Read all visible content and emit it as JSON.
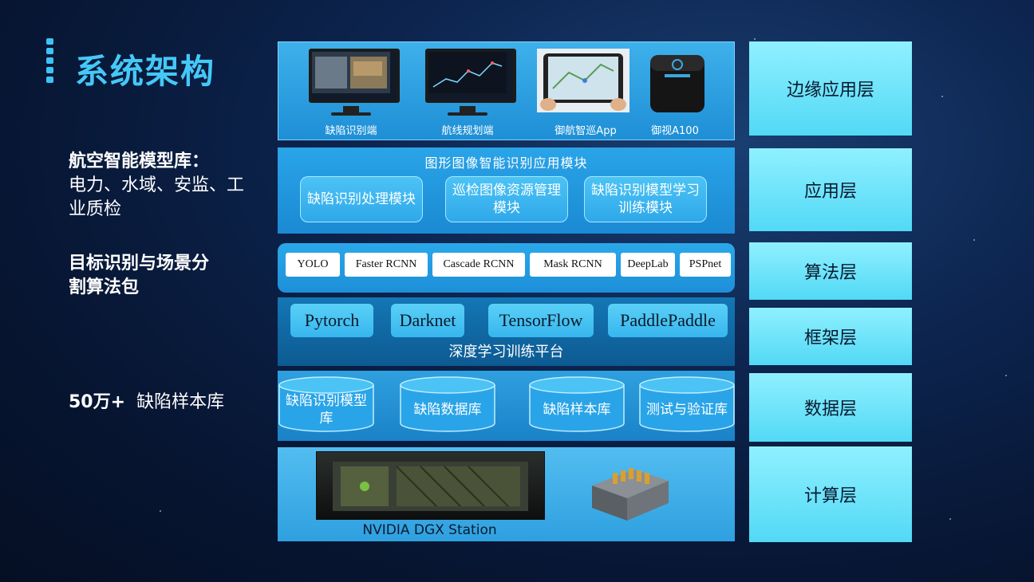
{
  "title": "系统架构",
  "notes": [
    {
      "bold": "航空智能模型库：",
      "text": "电力、水域、安监、工业质检"
    },
    {
      "bold": "目标识别与场景分割算法包",
      "text": ""
    },
    {
      "bold": "50万+",
      "text": "缺陷样本库"
    }
  ],
  "layers": {
    "edge": {
      "label": "边缘应用层",
      "devices": [
        "缺陷识别端",
        "航线规划端",
        "御航智巡App",
        "御视A100"
      ]
    },
    "app": {
      "label": "应用层",
      "title": "图形图像智能识别应用模块",
      "modules": [
        "缺陷识别处理模块",
        "巡检图像资源管理模块",
        "缺陷识别模型学习训练模块"
      ]
    },
    "algo": {
      "label": "算法层",
      "items": [
        "YOLO",
        "Faster RCNN",
        "Cascade RCNN",
        "Mask RCNN",
        "DeepLab",
        "PSPnet"
      ]
    },
    "framework": {
      "label": "框架层",
      "items": [
        "Pytorch",
        "Darknet",
        "TensorFlow",
        "PaddlePaddle"
      ],
      "caption": "深度学习训练平台"
    },
    "data": {
      "label": "数据层",
      "items": [
        "缺陷识别模型库",
        "缺陷数据库",
        "缺陷样本库",
        "测试与验证库"
      ]
    },
    "compute": {
      "label": "计算层",
      "caption": "NVIDIA DGX Station"
    }
  }
}
